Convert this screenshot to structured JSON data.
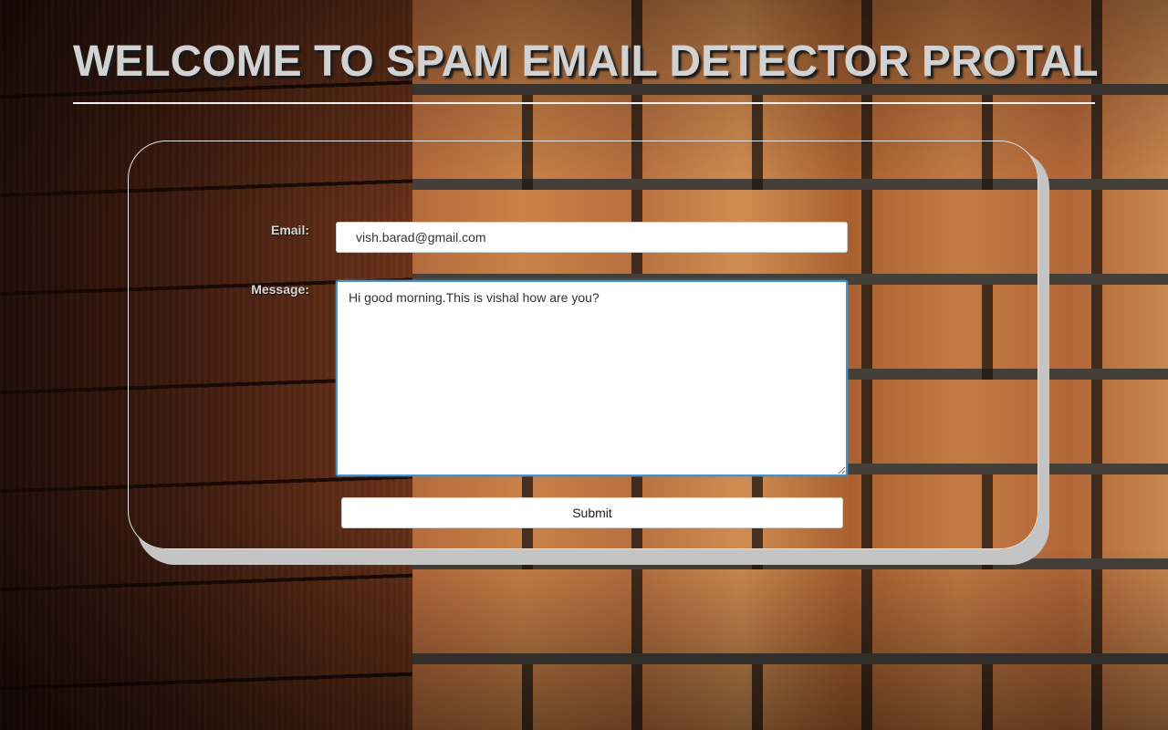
{
  "header": {
    "title": "WELCOME TO SPAM EMAIL DETECTOR PROTAL"
  },
  "form": {
    "email_label": "Email:",
    "email_value": "vish.barad@gmail.com",
    "message_label": "Message:",
    "message_value": "Hi good morning.This is vishal how are you?",
    "submit_label": "Submit"
  },
  "colors": {
    "title_text": "#d2d2d2",
    "label_text": "#d6d6d6",
    "focus_border": "#4a90c8",
    "card_border": "#e6e6e6",
    "card_shadow": "#c4c4c4"
  }
}
